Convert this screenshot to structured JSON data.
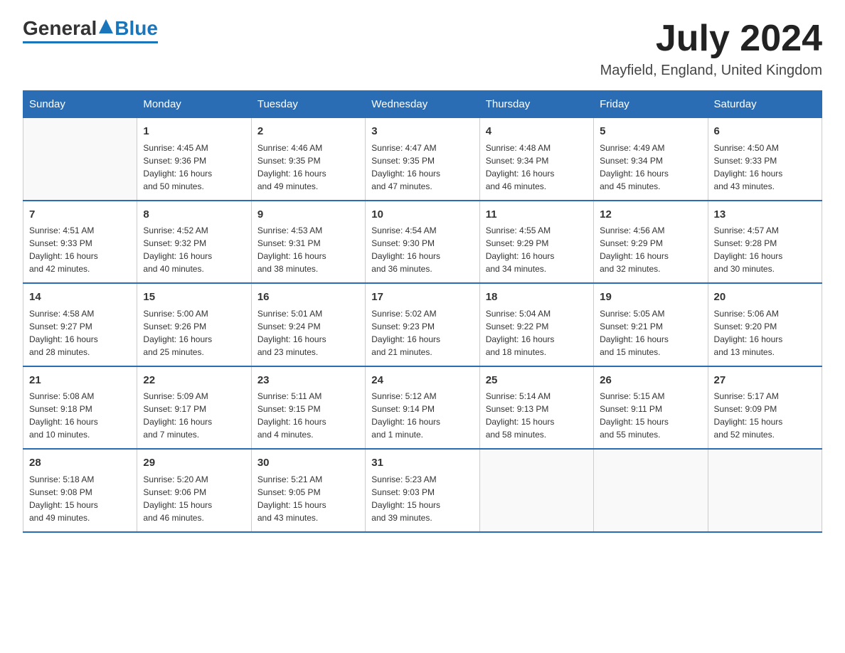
{
  "header": {
    "logo_general": "General",
    "logo_blue": "Blue",
    "month_title": "July 2024",
    "location": "Mayfield, England, United Kingdom"
  },
  "weekdays": [
    "Sunday",
    "Monday",
    "Tuesday",
    "Wednesday",
    "Thursday",
    "Friday",
    "Saturday"
  ],
  "weeks": [
    [
      {
        "day": "",
        "info": ""
      },
      {
        "day": "1",
        "info": "Sunrise: 4:45 AM\nSunset: 9:36 PM\nDaylight: 16 hours\nand 50 minutes."
      },
      {
        "day": "2",
        "info": "Sunrise: 4:46 AM\nSunset: 9:35 PM\nDaylight: 16 hours\nand 49 minutes."
      },
      {
        "day": "3",
        "info": "Sunrise: 4:47 AM\nSunset: 9:35 PM\nDaylight: 16 hours\nand 47 minutes."
      },
      {
        "day": "4",
        "info": "Sunrise: 4:48 AM\nSunset: 9:34 PM\nDaylight: 16 hours\nand 46 minutes."
      },
      {
        "day": "5",
        "info": "Sunrise: 4:49 AM\nSunset: 9:34 PM\nDaylight: 16 hours\nand 45 minutes."
      },
      {
        "day": "6",
        "info": "Sunrise: 4:50 AM\nSunset: 9:33 PM\nDaylight: 16 hours\nand 43 minutes."
      }
    ],
    [
      {
        "day": "7",
        "info": "Sunrise: 4:51 AM\nSunset: 9:33 PM\nDaylight: 16 hours\nand 42 minutes."
      },
      {
        "day": "8",
        "info": "Sunrise: 4:52 AM\nSunset: 9:32 PM\nDaylight: 16 hours\nand 40 minutes."
      },
      {
        "day": "9",
        "info": "Sunrise: 4:53 AM\nSunset: 9:31 PM\nDaylight: 16 hours\nand 38 minutes."
      },
      {
        "day": "10",
        "info": "Sunrise: 4:54 AM\nSunset: 9:30 PM\nDaylight: 16 hours\nand 36 minutes."
      },
      {
        "day": "11",
        "info": "Sunrise: 4:55 AM\nSunset: 9:29 PM\nDaylight: 16 hours\nand 34 minutes."
      },
      {
        "day": "12",
        "info": "Sunrise: 4:56 AM\nSunset: 9:29 PM\nDaylight: 16 hours\nand 32 minutes."
      },
      {
        "day": "13",
        "info": "Sunrise: 4:57 AM\nSunset: 9:28 PM\nDaylight: 16 hours\nand 30 minutes."
      }
    ],
    [
      {
        "day": "14",
        "info": "Sunrise: 4:58 AM\nSunset: 9:27 PM\nDaylight: 16 hours\nand 28 minutes."
      },
      {
        "day": "15",
        "info": "Sunrise: 5:00 AM\nSunset: 9:26 PM\nDaylight: 16 hours\nand 25 minutes."
      },
      {
        "day": "16",
        "info": "Sunrise: 5:01 AM\nSunset: 9:24 PM\nDaylight: 16 hours\nand 23 minutes."
      },
      {
        "day": "17",
        "info": "Sunrise: 5:02 AM\nSunset: 9:23 PM\nDaylight: 16 hours\nand 21 minutes."
      },
      {
        "day": "18",
        "info": "Sunrise: 5:04 AM\nSunset: 9:22 PM\nDaylight: 16 hours\nand 18 minutes."
      },
      {
        "day": "19",
        "info": "Sunrise: 5:05 AM\nSunset: 9:21 PM\nDaylight: 16 hours\nand 15 minutes."
      },
      {
        "day": "20",
        "info": "Sunrise: 5:06 AM\nSunset: 9:20 PM\nDaylight: 16 hours\nand 13 minutes."
      }
    ],
    [
      {
        "day": "21",
        "info": "Sunrise: 5:08 AM\nSunset: 9:18 PM\nDaylight: 16 hours\nand 10 minutes."
      },
      {
        "day": "22",
        "info": "Sunrise: 5:09 AM\nSunset: 9:17 PM\nDaylight: 16 hours\nand 7 minutes."
      },
      {
        "day": "23",
        "info": "Sunrise: 5:11 AM\nSunset: 9:15 PM\nDaylight: 16 hours\nand 4 minutes."
      },
      {
        "day": "24",
        "info": "Sunrise: 5:12 AM\nSunset: 9:14 PM\nDaylight: 16 hours\nand 1 minute."
      },
      {
        "day": "25",
        "info": "Sunrise: 5:14 AM\nSunset: 9:13 PM\nDaylight: 15 hours\nand 58 minutes."
      },
      {
        "day": "26",
        "info": "Sunrise: 5:15 AM\nSunset: 9:11 PM\nDaylight: 15 hours\nand 55 minutes."
      },
      {
        "day": "27",
        "info": "Sunrise: 5:17 AM\nSunset: 9:09 PM\nDaylight: 15 hours\nand 52 minutes."
      }
    ],
    [
      {
        "day": "28",
        "info": "Sunrise: 5:18 AM\nSunset: 9:08 PM\nDaylight: 15 hours\nand 49 minutes."
      },
      {
        "day": "29",
        "info": "Sunrise: 5:20 AM\nSunset: 9:06 PM\nDaylight: 15 hours\nand 46 minutes."
      },
      {
        "day": "30",
        "info": "Sunrise: 5:21 AM\nSunset: 9:05 PM\nDaylight: 15 hours\nand 43 minutes."
      },
      {
        "day": "31",
        "info": "Sunrise: 5:23 AM\nSunset: 9:03 PM\nDaylight: 15 hours\nand 39 minutes."
      },
      {
        "day": "",
        "info": ""
      },
      {
        "day": "",
        "info": ""
      },
      {
        "day": "",
        "info": ""
      }
    ]
  ]
}
